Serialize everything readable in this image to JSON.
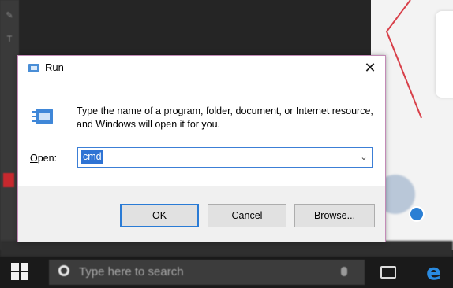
{
  "dialog": {
    "title": "Run",
    "prompt": "Type the name of a program, folder, document, or Internet resource, and Windows will open it for you.",
    "open_label_accel": "O",
    "open_label_rest": "pen:",
    "open_value": "cmd",
    "ok_label": "OK",
    "cancel_label": "Cancel",
    "browse_label_accel": "B",
    "browse_label_rest": "rowse...",
    "close_glyph": "✕",
    "dropdown_glyph": "⌄"
  },
  "taskbar": {
    "search_placeholder": "Type here to search"
  },
  "icons": {
    "title": "run-icon",
    "content": "run-icon",
    "close": "close-icon",
    "dropdown": "chevron-down-icon",
    "start": "windows-logo-icon",
    "search": "cortana-icon",
    "mic": "microphone-icon",
    "task_view": "task-view-icon",
    "browser": "edge-icon"
  },
  "colors": {
    "selection": "#2e73d4",
    "default_button_border": "#2a7bd5",
    "dialog_border": "#c38bb7",
    "taskbar": "#1a1a1a",
    "edge": "#2a8be0"
  }
}
